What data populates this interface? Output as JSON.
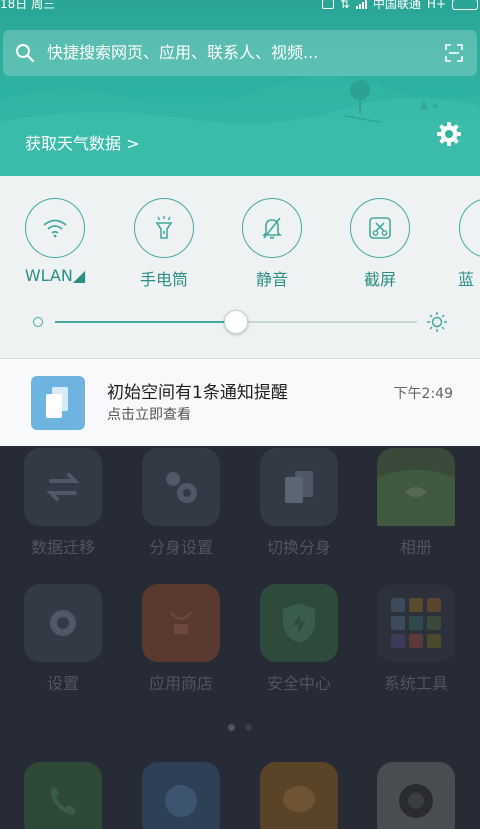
{
  "status_bar": {
    "date": "18日 周三",
    "carrier": "中国联通",
    "network": "H+"
  },
  "search": {
    "placeholder": "快捷搜索网页、应用、联系人、视频..."
  },
  "weather": {
    "label": "获取天气数据 >"
  },
  "quick_toggles": [
    {
      "label": "WLAN◢",
      "icon": "wifi-icon"
    },
    {
      "label": "手电筒",
      "icon": "flashlight-icon"
    },
    {
      "label": "静音",
      "icon": "mute-bell-icon"
    },
    {
      "label": "截屏",
      "icon": "screenshot-icon"
    },
    {
      "label": "蓝",
      "icon": "bluetooth-icon"
    }
  ],
  "brightness": {
    "level_percent": 50
  },
  "notification": {
    "title": "初始空间有1条通知提醒",
    "subtitle": "点击立即查看",
    "time": "下午2:49"
  },
  "home_apps": [
    {
      "name": "数据迁移",
      "icon": "transfer-icon"
    },
    {
      "name": "分身设置",
      "icon": "gears-icon"
    },
    {
      "name": "切换分身",
      "icon": "switch-icon"
    },
    {
      "name": "相册",
      "icon": "gallery-icon"
    },
    {
      "name": "设置",
      "icon": "settings-icon"
    },
    {
      "name": "应用商店",
      "icon": "store-icon"
    },
    {
      "name": "安全中心",
      "icon": "shield-icon"
    },
    {
      "name": "系统工具",
      "icon": "folder-icon"
    }
  ],
  "colors": {
    "accent": "#45a9a0",
    "header": "#2fb3a2"
  }
}
